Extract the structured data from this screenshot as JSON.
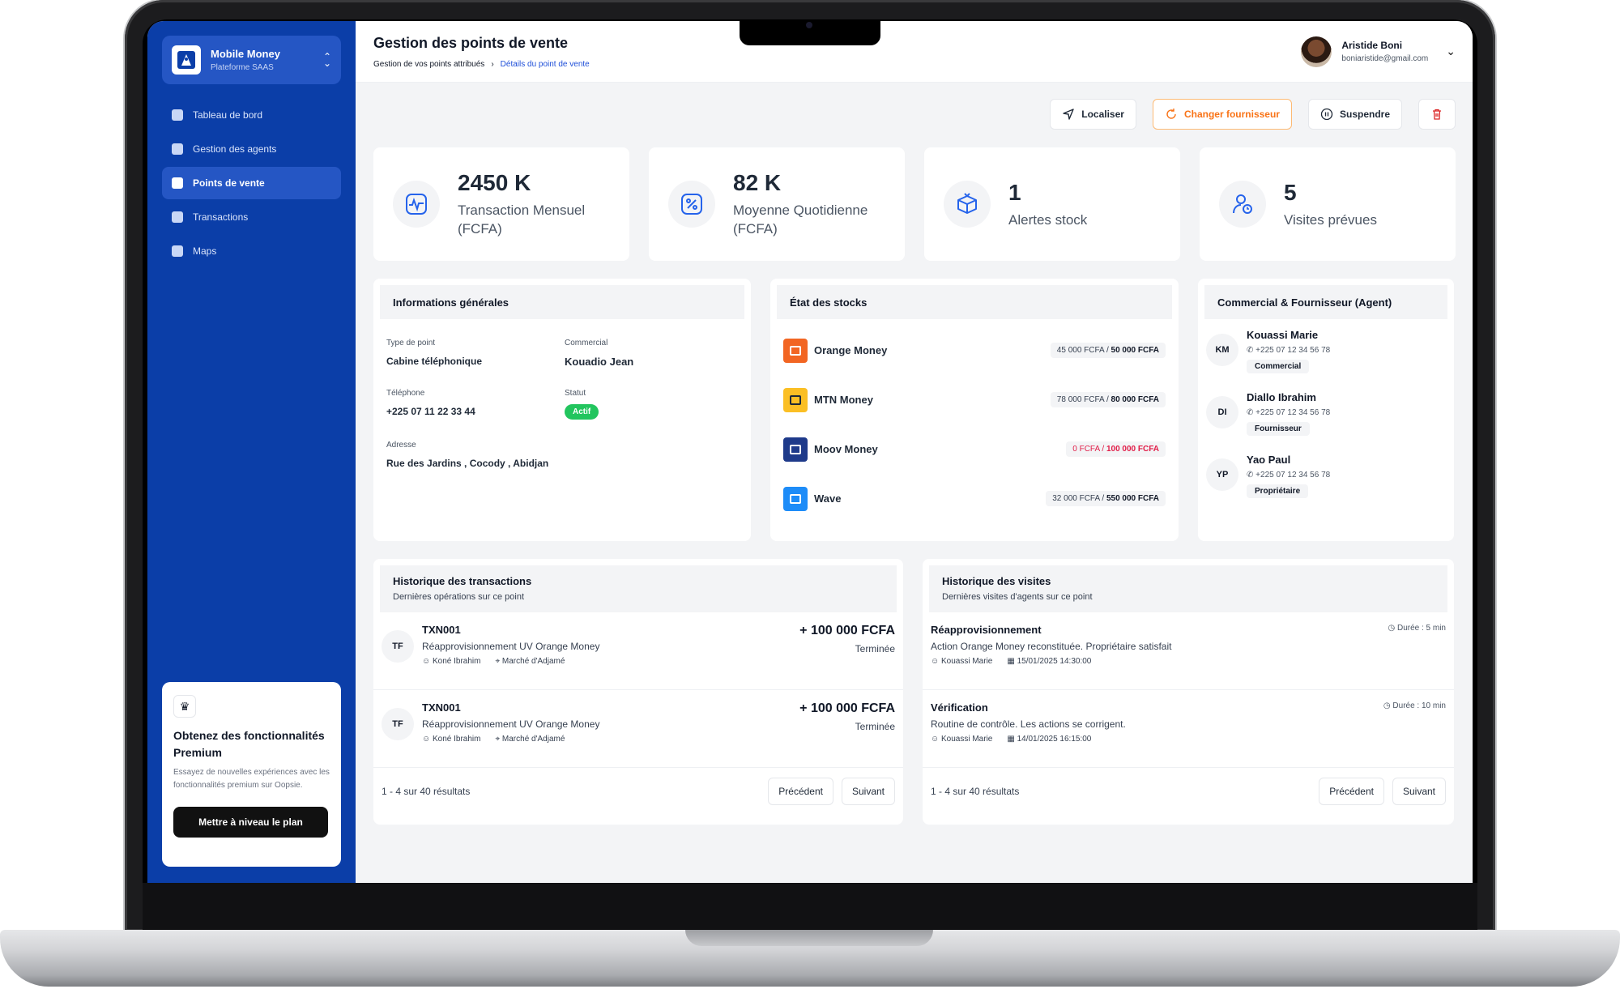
{
  "brand": {
    "title": "Mobile Money",
    "subtitle": "Plateforme SAAS"
  },
  "nav": [
    {
      "label": "Tableau de bord",
      "icon": "dashboard-icon"
    },
    {
      "label": "Gestion des agents",
      "icon": "agents-icon"
    },
    {
      "label": "Points de vente",
      "icon": "store-icon",
      "active": true
    },
    {
      "label": "Transactions",
      "icon": "transactions-icon"
    },
    {
      "label": "Maps",
      "icon": "map-icon"
    }
  ],
  "promo": {
    "title": "Obtenez des fonctionnalités Premium",
    "description": "Essayez de nouvelles expériences avec les fonctionnalités premium sur Oopsie.",
    "button": "Mettre à niveau le plan"
  },
  "header": {
    "title": "Gestion des points de vente",
    "breadcrumb": [
      "Gestion de vos points attribués",
      "Détails du point de vente"
    ],
    "user_name": "Aristide Boni",
    "user_email": "boniaristide@gmail.com"
  },
  "actions": {
    "locate": "Localiser",
    "change_supplier": "Changer fournisseur",
    "suspend": "Suspendre"
  },
  "kpis": [
    {
      "value": "2450 K",
      "label": "Transaction Mensuel (FCFA)"
    },
    {
      "value": "82 K",
      "label": "Moyenne Quotidienne (FCFA)"
    },
    {
      "value": "1",
      "label": "Alertes stock"
    },
    {
      "value": "5",
      "label": "Visites prévues"
    }
  ],
  "info": {
    "title": "Informations générales",
    "type_label": "Type de point",
    "type_value": "Cabine téléphonique",
    "commercial_label": "Commercial",
    "commercial_value": "Kouadio Jean",
    "phone_label": "Téléphone",
    "phone_value": "+225 07 11 22 33 44",
    "status_label": "Statut",
    "status_value": "Actif",
    "address_label": "Adresse",
    "address_value": "Rue des Jardins , Cocody , Abidjan"
  },
  "stocks": {
    "title": "État des stocks",
    "items": [
      {
        "name": "Orange Money",
        "current": "45 000 FCFA",
        "max": "50 000 FCFA",
        "color": "#f26522"
      },
      {
        "name": "MTN Money",
        "current": "78 000 FCFA",
        "max": "80 000 FCFA",
        "color": "#fbbf24"
      },
      {
        "name": "Moov Money",
        "current": "0 FCFA",
        "max": "100 000 FCFA",
        "color": "#1e3a8a",
        "alert": true
      },
      {
        "name": "Wave",
        "current": "32 000 FCFA",
        "max": "550 000 FCFA",
        "color": "#1d8cf8"
      }
    ]
  },
  "agents": {
    "title": "Commercial  & Fournisseur (Agent)",
    "items": [
      {
        "initials": "KM",
        "name": "Kouassi Marie",
        "phone": "+225 07 12 34 56 78",
        "role": "Commercial"
      },
      {
        "initials": "DI",
        "name": "Diallo Ibrahim",
        "phone": "+225 07 12 34 56 78",
        "role": "Fournisseur"
      },
      {
        "initials": "YP",
        "name": "Yao Paul",
        "phone": "+225 07 12 34 56 78",
        "role": "Propriétaire"
      }
    ]
  },
  "transactions": {
    "title": "Historique des transactions",
    "subtitle": "Dernières opérations sur ce point",
    "items": [
      {
        "initials": "TF",
        "id": "TXN001",
        "desc": "Réapprovisionnement UV Orange Money",
        "agent": "Koné Ibrahim",
        "place": "Marché d'Adjamé",
        "amount": "+ 100 000 FCFA",
        "status": "Terminée"
      },
      {
        "initials": "TF",
        "id": "TXN001",
        "desc": "Réapprovisionnement UV Orange Money",
        "agent": "Koné Ibrahim",
        "place": "Marché d'Adjamé",
        "amount": "+ 100 000 FCFA",
        "status": "Terminée"
      }
    ],
    "pager_text": "1 - 4 sur 40 résultats",
    "prev": "Précédent",
    "next": "Suivant"
  },
  "visits": {
    "title": "Historique des visites",
    "subtitle": "Dernières visites d'agents sur ce point",
    "items": [
      {
        "title": "Réapprovisionnement",
        "duration": "Durée : 5 min",
        "desc": "Action Orange Money reconstituée. Propriétaire satisfait",
        "agent": "Kouassi Marie",
        "date": "15/01/2025 14:30:00"
      },
      {
        "title": "Vérification",
        "duration": "Durée : 10 min",
        "desc": "Routine de contrôle. Les actions se corrigent.",
        "agent": "Kouassi Marie",
        "date": "14/01/2025 16:15:00"
      }
    ],
    "pager_text": "1 - 4 sur 40 résultats",
    "prev": "Précédent",
    "next": "Suivant"
  }
}
